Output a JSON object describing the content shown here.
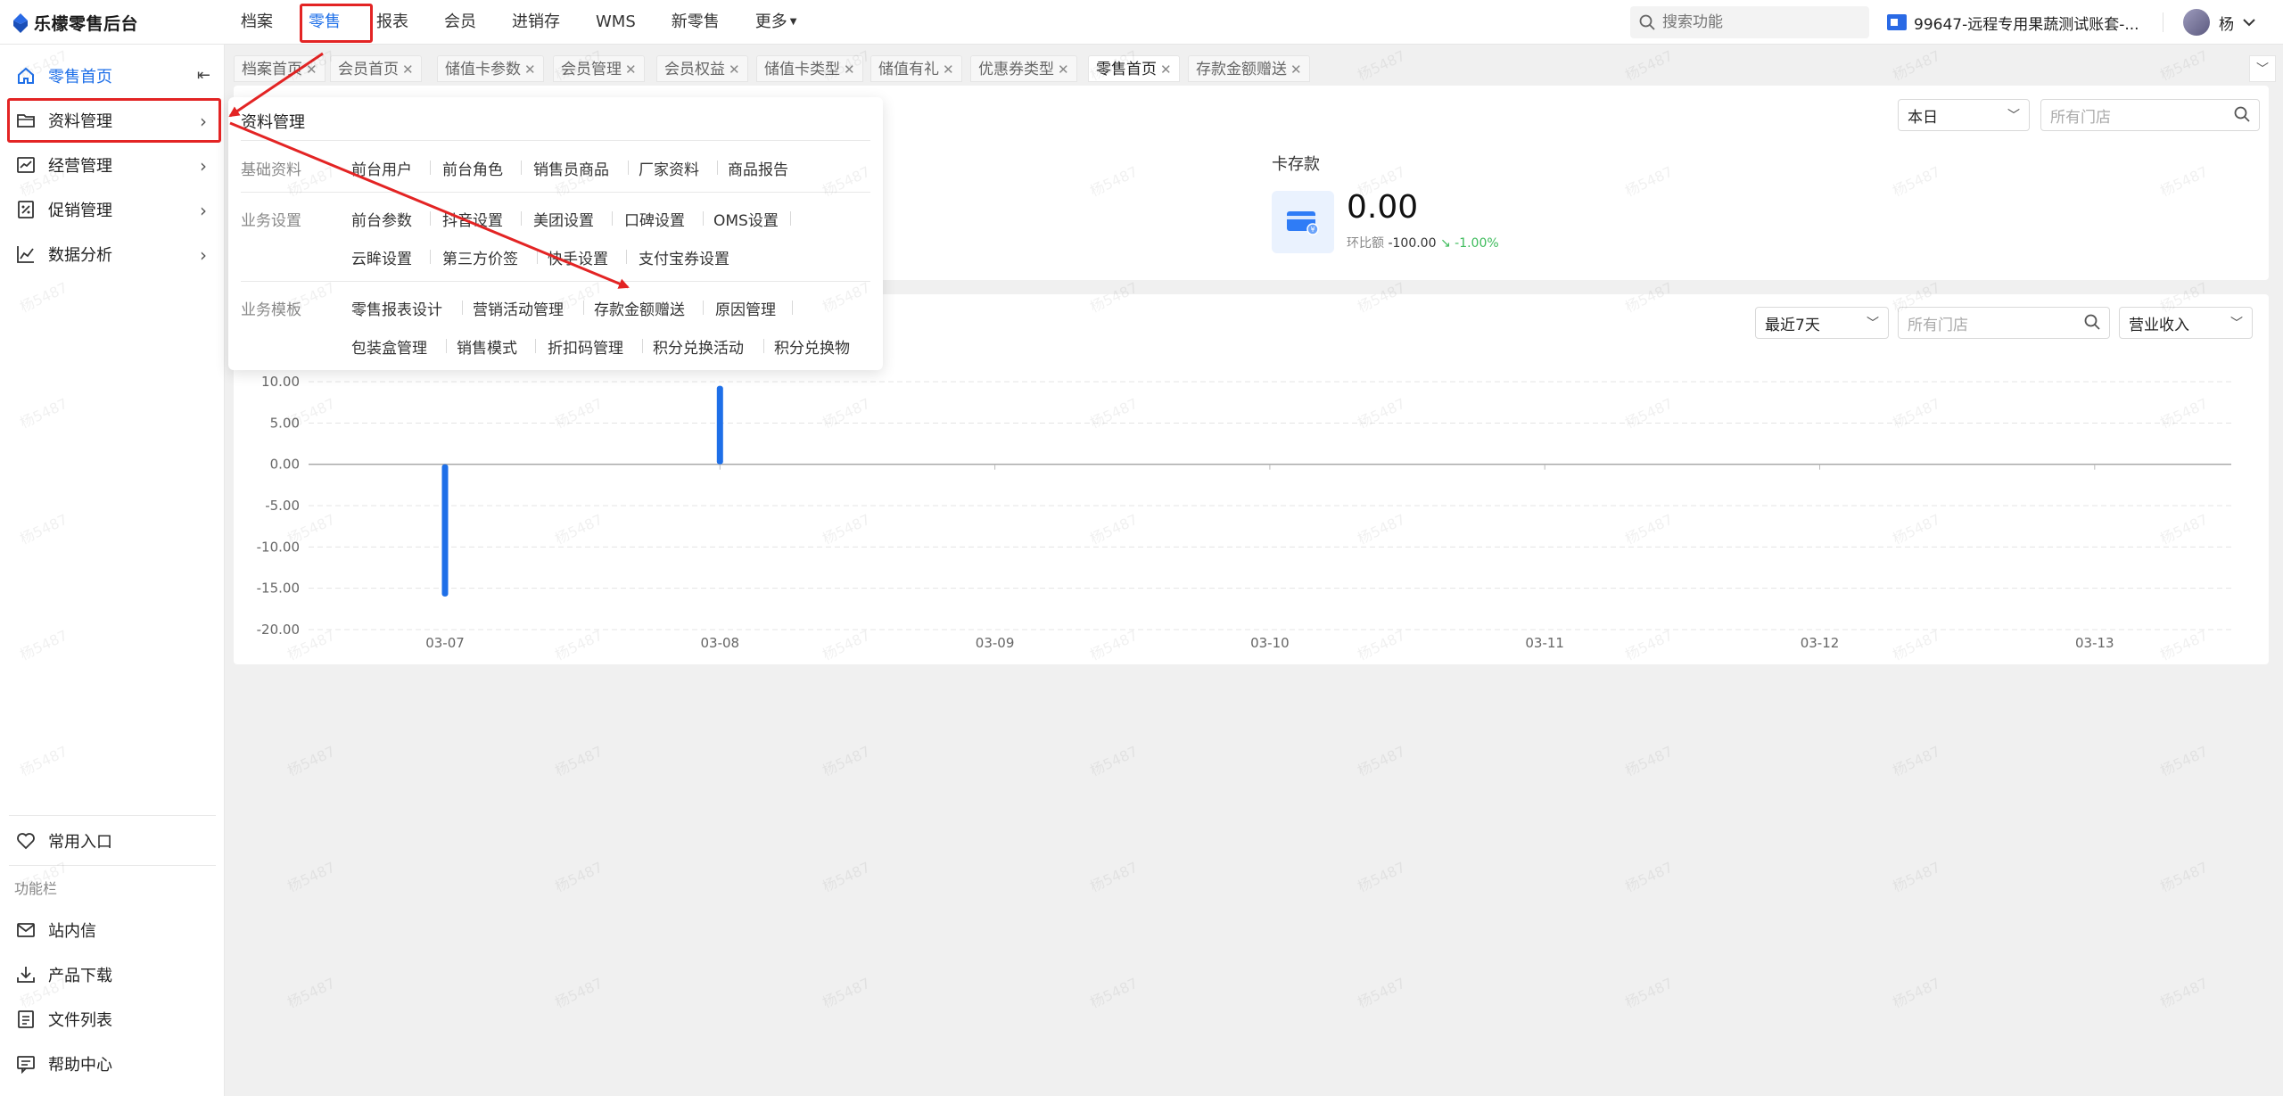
{
  "app": {
    "title": "乐檬零售后台"
  },
  "topnav": {
    "items": [
      {
        "label": "档案"
      },
      {
        "label": "零售",
        "active": true
      },
      {
        "label": "报表"
      },
      {
        "label": "会员"
      },
      {
        "label": "进销存"
      },
      {
        "label": "WMS"
      },
      {
        "label": "新零售"
      },
      {
        "label": "更多"
      }
    ],
    "search_placeholder": "搜索功能",
    "account": "99647-远程专用果蔬测试账套-...",
    "user": "杨"
  },
  "sidebar": {
    "items": [
      {
        "label": "零售首页",
        "icon": "home-icon"
      },
      {
        "label": "资料管理",
        "icon": "folder-icon"
      },
      {
        "label": "经营管理",
        "icon": "trend-icon"
      },
      {
        "label": "促销管理",
        "icon": "promo-icon"
      },
      {
        "label": "数据分析",
        "icon": "analytics-icon"
      }
    ],
    "favorites": "常用入口",
    "section_label": "功能栏",
    "tools": [
      {
        "label": "站内信",
        "icon": "mail-icon"
      },
      {
        "label": "产品下载",
        "icon": "download-icon"
      },
      {
        "label": "文件列表",
        "icon": "file-list-icon"
      },
      {
        "label": "帮助中心",
        "icon": "help-icon"
      }
    ]
  },
  "tabs": [
    {
      "label": "档案首页"
    },
    {
      "label": "会员首页"
    },
    {
      "label": "储值卡参数"
    },
    {
      "label": "会员管理"
    },
    {
      "label": "会员权益"
    },
    {
      "label": "储值卡类型"
    },
    {
      "label": "储值有礼"
    },
    {
      "label": "优惠券类型"
    },
    {
      "label": "零售首页",
      "active": true
    },
    {
      "label": "存款金额赠送"
    }
  ],
  "summary": {
    "period": "本日",
    "store_placeholder": "所有门店",
    "kpi": {
      "label": "卡存款",
      "value": "0.00",
      "sub_label": "环比额",
      "sub_value": "-100.00",
      "sub_pct": "-1.00%"
    }
  },
  "chart_panel": {
    "period": "最近7天",
    "store_placeholder": "所有门店",
    "metric": "营业收入"
  },
  "chart_data": {
    "type": "bar",
    "categories": [
      "03-07",
      "03-08",
      "03-09",
      "03-10",
      "03-11",
      "03-12",
      "03-13"
    ],
    "values": [
      -16,
      9.5,
      0,
      0,
      0,
      0,
      0
    ],
    "ylim": [
      -20,
      10
    ],
    "yticks": [
      "10.00",
      "5.00",
      "0.00",
      "-5.00",
      "-10.00",
      "-15.00",
      "-20.00"
    ],
    "tick_values": [
      10,
      5,
      0,
      -5,
      -10,
      -15,
      -20
    ],
    "title": "",
    "xlabel": "",
    "ylabel": "",
    "grid": true,
    "bar_color": "#1e6fe8"
  },
  "popup": {
    "title": "资料管理",
    "groups": [
      {
        "label": "基础资料",
        "rows": [
          [
            "前台用户",
            "前台角色",
            "销售员商品",
            "厂家资料",
            "商品报告"
          ]
        ]
      },
      {
        "label": "业务设置",
        "rows": [
          [
            "前台参数",
            "抖音设置",
            "美团设置",
            "口碑设置",
            "OMS设置"
          ],
          [
            "云眸设置",
            "第三方价签",
            "快手设置",
            "支付宝券设置"
          ]
        ]
      },
      {
        "label": "业务模板",
        "rows": [
          [
            "零售报表设计",
            "营销活动管理",
            "存款金额赠送",
            "原因管理"
          ],
          [
            "包装盒管理",
            "销售模式",
            "折扣码管理",
            "积分兑换活动",
            "积分兑换物"
          ]
        ]
      }
    ]
  },
  "watermark": "杨5487",
  "colors": {
    "accent": "#1e6fe8",
    "annotation": "#e32424"
  }
}
